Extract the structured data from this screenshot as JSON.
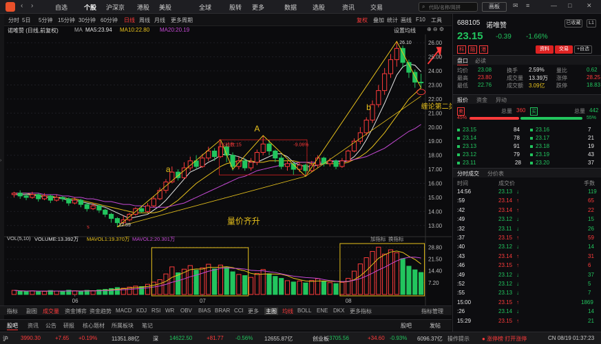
{
  "nav": {
    "logo": "app-logo",
    "items": [
      "自选",
      "个股",
      "沪深京",
      "港股",
      "美股",
      "全球",
      "股转",
      "更多",
      "数据",
      "选股",
      "资讯",
      "交易"
    ],
    "active_index": 1,
    "search_placeholder": "代码/名称/简拼",
    "window_btn": "画板"
  },
  "timeframes": {
    "items": [
      "分时",
      "5日",
      "5分钟",
      "15分钟",
      "30分钟",
      "60分钟",
      "日线",
      "周线",
      "月线",
      "更多周期"
    ],
    "active_index": 6,
    "right": [
      "复权",
      "叠加",
      "统计",
      "画线",
      "F10",
      "工具",
      "设置均线"
    ]
  },
  "stock": {
    "legend_title": "诺唯赞 (日线,前复权)",
    "ma_label": "MA",
    "ma5": "MA5:23.94",
    "ma10": "MA10:22.80",
    "ma20": "MA20:20.19"
  },
  "chart_data": {
    "type": "candlestick",
    "y_ticks": [
      "26.00",
      "25.00",
      "24.00",
      "23.00",
      "22.00",
      "21.00",
      "20.00",
      "19.00",
      "18.00",
      "17.00",
      "16.00",
      "15.00",
      "14.00",
      "13.00"
    ],
    "ylim": [
      12.5,
      26.4
    ],
    "x_labels": [
      "06",
      "07",
      "08"
    ],
    "high_label": "26.10",
    "low_label": "12.89",
    "candles": [
      [
        15.2,
        15.3,
        15.0,
        15.4
      ],
      [
        15.3,
        15.1,
        14.9,
        15.5
      ],
      [
        15.1,
        15.0,
        14.8,
        15.3
      ],
      [
        15.0,
        15.2,
        14.9,
        15.4
      ],
      [
        15.2,
        14.9,
        14.7,
        15.3
      ],
      [
        14.9,
        15.1,
        14.8,
        15.3
      ],
      [
        15.1,
        14.8,
        14.6,
        15.2
      ],
      [
        14.8,
        15.0,
        14.7,
        15.2
      ],
      [
        15.0,
        14.9,
        14.7,
        15.1
      ],
      [
        14.9,
        14.6,
        14.4,
        15.0
      ],
      [
        14.6,
        14.8,
        14.5,
        15.0
      ],
      [
        14.8,
        14.5,
        14.3,
        14.9
      ],
      [
        14.5,
        14.2,
        14.0,
        14.6
      ],
      [
        14.2,
        14.4,
        14.1,
        14.6
      ],
      [
        14.4,
        14.1,
        13.9,
        14.5
      ],
      [
        14.1,
        13.8,
        13.6,
        14.2
      ],
      [
        13.8,
        13.5,
        13.2,
        13.9
      ],
      [
        13.5,
        13.2,
        12.89,
        13.6
      ],
      [
        13.2,
        13.4,
        13.1,
        13.7
      ],
      [
        13.4,
        13.8,
        13.3,
        13.9
      ],
      [
        13.8,
        14.2,
        13.7,
        14.3
      ],
      [
        14.2,
        14.0,
        13.9,
        14.4
      ],
      [
        14.0,
        14.4,
        13.9,
        14.6
      ],
      [
        14.4,
        14.9,
        14.3,
        15.1
      ],
      [
        14.9,
        15.5,
        14.8,
        15.7
      ],
      [
        15.5,
        16.1,
        15.3,
        16.3
      ],
      [
        16.1,
        16.8,
        16.0,
        17.2
      ],
      [
        16.8,
        16.4,
        16.2,
        17.0
      ],
      [
        16.4,
        17.1,
        16.3,
        17.5
      ],
      [
        17.1,
        17.6,
        16.9,
        17.9
      ],
      [
        17.6,
        17.2,
        17.0,
        18.0
      ],
      [
        17.2,
        17.8,
        17.1,
        18.1
      ],
      [
        17.8,
        18.3,
        17.6,
        18.6
      ],
      [
        18.3,
        17.9,
        17.6,
        18.5
      ],
      [
        17.9,
        18.6,
        17.8,
        19.0
      ],
      [
        18.6,
        18.0,
        17.5,
        18.8
      ],
      [
        18.0,
        17.2,
        16.9,
        18.2
      ],
      [
        17.2,
        17.6,
        17.0,
        17.9
      ],
      [
        17.6,
        17.1,
        16.9,
        17.8
      ],
      [
        17.1,
        17.5,
        16.9,
        17.8
      ],
      [
        17.5,
        18.2,
        17.3,
        18.4
      ],
      [
        18.2,
        18.8,
        18.0,
        19.4
      ],
      [
        18.8,
        18.3,
        18.0,
        19.1
      ],
      [
        18.3,
        17.8,
        17.5,
        18.4
      ],
      [
        17.8,
        17.2,
        17.0,
        18.0
      ],
      [
        17.2,
        17.4,
        16.9,
        17.6
      ],
      [
        17.4,
        17.0,
        16.6,
        17.5
      ],
      [
        17.0,
        17.3,
        16.8,
        17.5
      ],
      [
        17.3,
        16.9,
        16.5,
        17.4
      ],
      [
        16.9,
        17.3,
        16.8,
        17.6
      ],
      [
        17.3,
        17.8,
        17.1,
        18.0
      ],
      [
        17.8,
        17.4,
        17.2,
        17.9
      ],
      [
        17.4,
        17.6,
        17.2,
        17.8
      ],
      [
        17.6,
        17.2,
        17.0,
        17.7
      ],
      [
        17.2,
        17.6,
        17.1,
        17.8
      ],
      [
        17.6,
        18.3,
        17.5,
        18.4
      ],
      [
        18.3,
        19.0,
        18.2,
        19.2
      ],
      [
        19.0,
        19.6,
        18.8,
        20.0
      ],
      [
        19.6,
        20.5,
        19.4,
        20.7
      ],
      [
        20.5,
        21.6,
        20.3,
        21.9
      ],
      [
        21.6,
        22.6,
        21.4,
        23.0
      ],
      [
        22.6,
        23.8,
        22.3,
        24.2
      ],
      [
        23.8,
        24.8,
        23.5,
        25.2
      ],
      [
        24.8,
        25.6,
        24.3,
        26.1
      ],
      [
        25.6,
        24.6,
        24.2,
        25.8
      ],
      [
        24.6,
        23.9,
        23.5,
        24.8
      ],
      [
        23.9,
        23.2,
        22.8,
        24.1
      ],
      [
        23.2,
        23.15,
        22.76,
        23.8
      ]
    ],
    "ma5": [
      15.2,
      15.2,
      15.2,
      15.2,
      15.1,
      15.0,
      15.0,
      15.0,
      14.9,
      14.8,
      14.8,
      14.7,
      14.6,
      14.5,
      14.4,
      14.3,
      14.1,
      13.9,
      13.7,
      13.5,
      13.6,
      13.7,
      13.8,
      14.1,
      14.4,
      14.8,
      15.3,
      15.8,
      16.3,
      16.8,
      17.0,
      17.2,
      17.5,
      17.7,
      18.0,
      18.1,
      18.0,
      17.9,
      17.7,
      17.5,
      17.5,
      17.7,
      17.9,
      18.1,
      18.1,
      17.9,
      17.5,
      17.3,
      17.2,
      17.2,
      17.3,
      17.4,
      17.5,
      17.6,
      17.5,
      17.6,
      17.9,
      18.4,
      19.1,
      19.9,
      20.8,
      21.7,
      22.7,
      23.7,
      24.3,
      24.5,
      24.4,
      23.94
    ],
    "ma10": [
      15.3,
      15.3,
      15.3,
      15.2,
      15.2,
      15.1,
      15.1,
      15.0,
      15.0,
      14.9,
      14.9,
      14.8,
      14.7,
      14.6,
      14.5,
      14.4,
      14.3,
      14.2,
      14.1,
      14.0,
      13.9,
      13.9,
      13.9,
      13.9,
      14.0,
      14.2,
      14.5,
      14.8,
      15.2,
      15.6,
      16.0,
      16.3,
      16.6,
      16.9,
      17.2,
      17.4,
      17.5,
      17.6,
      17.6,
      17.6,
      17.5,
      17.5,
      17.6,
      17.6,
      17.6,
      17.6,
      17.6,
      17.5,
      17.5,
      17.4,
      17.4,
      17.4,
      17.4,
      17.4,
      17.4,
      17.5,
      17.7,
      17.9,
      18.2,
      18.6,
      19.1,
      19.6,
      20.2,
      20.8,
      21.4,
      22.0,
      22.4,
      22.8
    ],
    "ma20": [
      15.3,
      15.3,
      15.3,
      15.3,
      15.3,
      15.2,
      15.2,
      15.2,
      15.1,
      15.1,
      15.0,
      15.0,
      14.9,
      14.9,
      14.8,
      14.7,
      14.7,
      14.6,
      14.5,
      14.5,
      14.4,
      14.4,
      14.3,
      14.3,
      14.3,
      14.3,
      14.4,
      14.5,
      14.6,
      14.8,
      15.0,
      15.2,
      15.4,
      15.6,
      15.8,
      16.0,
      16.2,
      16.4,
      16.5,
      16.7,
      16.9,
      17.0,
      17.1,
      17.2,
      17.3,
      17.4,
      17.4,
      17.5,
      17.5,
      17.5,
      17.5,
      17.5,
      17.6,
      17.6,
      17.6,
      17.6,
      17.7,
      17.8,
      17.9,
      18.1,
      18.3,
      18.5,
      18.8,
      19.1,
      19.4,
      19.7,
      19.9,
      20.19
    ],
    "volume_series": {
      "title": "VOL(5,10)",
      "vol": "VOLUME:13.392万",
      "mavol1": "MAVOL1:19.370万",
      "mavol2": "MAVOL2:20.301万",
      "y_ticks": [
        "28.80",
        "21.50",
        "14.40",
        "7.20"
      ],
      "ylim": [
        0,
        31
      ],
      "values": [
        2.5,
        2.0,
        1.8,
        2.2,
        2.0,
        1.9,
        2.4,
        2.1,
        1.8,
        2.6,
        2.2,
        2.0,
        2.5,
        2.2,
        2.8,
        3.1,
        3.6,
        4.2,
        3.8,
        4.5,
        5.1,
        4.8,
        6.2,
        7.5,
        9.0,
        12.5,
        16.8,
        13.2,
        15.4,
        17.6,
        14.8,
        16.2,
        18.4,
        15.6,
        17.9,
        16.4,
        13.8,
        12.2,
        11.5,
        10.4,
        12.8,
        15.2,
        12.6,
        11.0,
        9.8,
        8.4,
        7.6,
        8.2,
        7.0,
        8.5,
        9.6,
        7.8,
        7.2,
        6.6,
        7.4,
        9.8,
        14.2,
        18.6,
        22.4,
        26.2,
        28.8,
        24.6,
        27.2,
        25.4,
        21.8,
        17.2,
        15.0,
        13.392
      ]
    }
  },
  "annotations": {
    "a": "a",
    "A": "A",
    "b": "b",
    "c": "c",
    "kcount": "K线数:15",
    "pct": "-9.06%",
    "s": "s",
    "b2": "b",
    "volume_text": "量价齐升",
    "buy_text": "缠论第二类买点"
  },
  "vol_toolbar": [
    "加指标",
    "换指标"
  ],
  "indicators": {
    "items": [
      "指标",
      "副图",
      "成交量",
      "资金博弈",
      "资金趋势",
      "MACD",
      "KDJ",
      "RSI",
      "WR",
      "OBV",
      "BIAS",
      "BRAR",
      "CCI",
      "更多",
      "主图",
      "均线",
      "BOLL",
      "ENE",
      "DKX",
      "更多指标",
      "指标管理"
    ],
    "active": [
      "成交量",
      "均线"
    ]
  },
  "bottom_tabs": [
    "股吧",
    "资讯",
    "公告",
    "研报",
    "核心题材",
    "所属板块",
    "笔记"
  ],
  "bottom_right": [
    "股吧",
    "发帖"
  ],
  "status": {
    "items": [
      {
        "label": "沪",
        "value": "3990.30",
        "chg": "+7.65",
        "pct": "+0.19%",
        "amt": "11351.88亿",
        "dir": "up"
      },
      {
        "label": "深",
        "value": "14622.50",
        "chg": "+81.77",
        "pct": "-0.56%",
        "amt": "12655.87亿",
        "dir": "down"
      },
      {
        "label": "创业板",
        "value": "3705.56",
        "chg": "+34.60",
        "pct": "-0.93%",
        "amt": "6096.37亿",
        "dir": "down"
      }
    ],
    "right_note": "操作提示",
    "right_text": "● 涨停榜 打开涨停",
    "clock": "CN 08/19 01:37:23"
  },
  "quote": {
    "code": "688105",
    "name": "诺唯赞",
    "fav": "已收藏",
    "level": "L1",
    "price": "23.15",
    "change": "-0.39",
    "pct": "-1.66%",
    "tags": [
      "科",
      "融",
      "港"
    ],
    "right_btns": [
      "资料",
      "交易",
      "+自选"
    ],
    "tabs": [
      "盘口",
      "必读"
    ],
    "stats": [
      [
        {
          "k": "均价",
          "v": "23.08",
          "c": "green"
        },
        {
          "k": "换手",
          "v": "2.59%",
          "c": "white"
        },
        {
          "k": "量比",
          "v": "0.62",
          "c": "green"
        }
      ],
      [
        {
          "k": "最高",
          "v": "23.80",
          "c": "red"
        },
        {
          "k": "成交量",
          "v": "13.39万",
          "c": "white"
        },
        {
          "k": "涨停",
          "v": "28.25",
          "c": "red"
        }
      ],
      [
        {
          "k": "最低",
          "v": "22.76",
          "c": "green"
        },
        {
          "k": "成交额",
          "v": "3.09亿",
          "c": "yellow"
        },
        {
          "k": "跌停",
          "v": "18.83",
          "c": "green"
        }
      ]
    ],
    "book_tabs": [
      "报价",
      "资金",
      "异动"
    ],
    "ratio": {
      "sell_label": "总量",
      "sell": "360",
      "buy_label": "总量",
      "buy": "442",
      "sell_pct": "45%",
      "buy_pct": "55%",
      "sell_tag": "卖",
      "buy_tag": "买"
    },
    "sells": [
      {
        "p": "23.15",
        "v": "84"
      },
      {
        "p": "23.14",
        "v": "78"
      },
      {
        "p": "23.13",
        "v": "91"
      },
      {
        "p": "23.12",
        "v": "79"
      },
      {
        "p": "23.11",
        "v": "28"
      }
    ],
    "buys": [
      {
        "p": "23.16",
        "v": "7"
      },
      {
        "p": "23.17",
        "v": "21"
      },
      {
        "p": "23.18",
        "v": "19"
      },
      {
        "p": "23.19",
        "v": "43"
      },
      {
        "p": "23.20",
        "v": "37"
      }
    ],
    "tick_tabs": [
      "分时成交",
      "分价表"
    ],
    "tick_head": [
      "时间",
      "成交价",
      "手数"
    ],
    "ticks": [
      {
        "t": "14:56",
        "p": "23.13",
        "d": "down",
        "v": "119",
        "vc": "green"
      },
      {
        "t": ":59",
        "p": "23.14",
        "d": "up",
        "v": "65",
        "vc": "red"
      },
      {
        "t": ":42",
        "p": "23.14",
        "d": "up",
        "v": "22",
        "vc": "red"
      },
      {
        "t": ":49",
        "p": "23.12",
        "d": "down",
        "v": "15",
        "vc": "green"
      },
      {
        "t": ":32",
        "p": "23.11",
        "d": "down",
        "v": "26",
        "vc": "green"
      },
      {
        "t": ":37",
        "p": "23.15",
        "d": "up",
        "v": "59",
        "vc": "red"
      },
      {
        "t": ":40",
        "p": "23.12",
        "d": "down",
        "v": "14",
        "vc": "green"
      },
      {
        "t": ":43",
        "p": "23.14",
        "d": "up",
        "v": "31",
        "vc": "red"
      },
      {
        "t": ":46",
        "p": "23.15",
        "d": "up",
        "v": "6",
        "vc": "red"
      },
      {
        "t": ":49",
        "p": "23.12",
        "d": "down",
        "v": "37",
        "vc": "green"
      },
      {
        "t": ":52",
        "p": "23.12",
        "d": "down",
        "v": "5",
        "vc": "green"
      },
      {
        "t": ":55",
        "p": "23.13",
        "d": "down",
        "v": "7",
        "vc": "green"
      },
      {
        "t": "15:00",
        "p": "23.15",
        "d": "up",
        "v": "1869",
        "vc": "green"
      },
      {
        "t": ":26",
        "p": "23.14",
        "d": "down",
        "v": "14",
        "vc": "green"
      },
      {
        "t": "15:29",
        "p": "23.15",
        "d": "up",
        "v": "21",
        "vc": "green"
      }
    ]
  }
}
